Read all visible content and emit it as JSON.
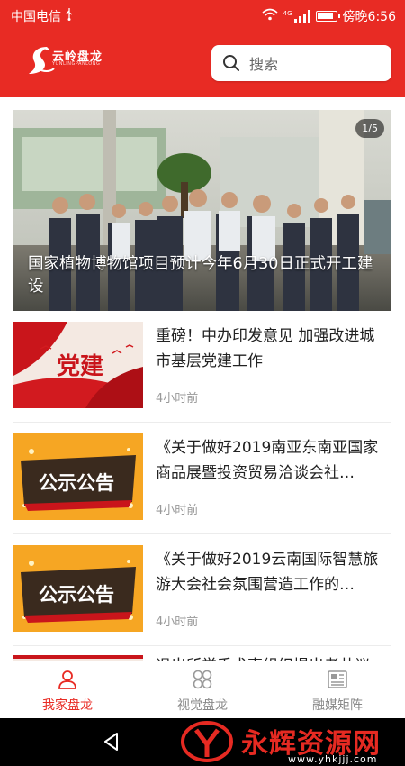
{
  "status_bar": {
    "carrier": "中国电信",
    "usb_icon": "usb-icon",
    "network_type": "4G",
    "time": "傍晚6:56"
  },
  "header": {
    "logo_text": "云岭盘龙",
    "logo_sub": "YUNLINGPANLONG",
    "search_placeholder": "搜索",
    "background_color": "#e82b24"
  },
  "banner": {
    "counter": "1/5",
    "caption": "国家植物博物馆项目预计今年6月30日正式开工建设"
  },
  "news": [
    {
      "title": "重磅！中办印发意见 加强改进城市基层党建工作",
      "time": "4小时前",
      "thumb_text": "党建"
    },
    {
      "title": "《关于做好2019南亚东南亚国家商品展暨投资贸易洽谈会社…",
      "time": "4小时前",
      "thumb_text": "公示公告"
    },
    {
      "title": "《关于做好2019云南国际智慧旅游大会社会氛围营造工作的…",
      "time": "4小时前",
      "thumb_text": "公示公告"
    },
    {
      "title": "退出所学手术事组织提出者共议",
      "time": "",
      "thumb_text": ""
    }
  ],
  "tabs": [
    {
      "label": "我家盘龙",
      "icon": "person-icon",
      "active": true
    },
    {
      "label": "视觉盘龙",
      "icon": "grid-icon",
      "active": false
    },
    {
      "label": "融媒矩阵",
      "icon": "newspaper-icon",
      "active": false
    }
  ],
  "watermark": {
    "brand": "永辉资源网",
    "url": "www.yhkjjj.com"
  }
}
